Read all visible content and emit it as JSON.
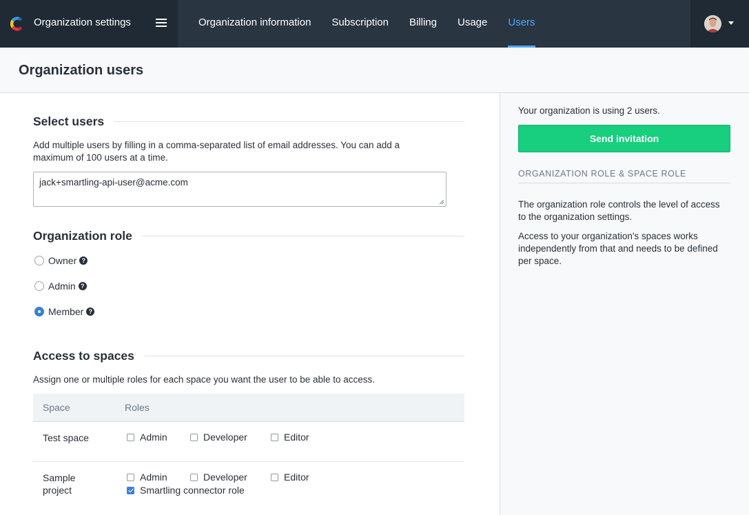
{
  "app": {
    "title": "Organization settings"
  },
  "nav": {
    "tabs": [
      {
        "label": "Organization information"
      },
      {
        "label": "Subscription"
      },
      {
        "label": "Billing"
      },
      {
        "label": "Usage"
      },
      {
        "label": "Users",
        "active": true
      }
    ]
  },
  "page": {
    "title": "Organization users"
  },
  "select_users": {
    "title": "Select users",
    "help": "Add multiple users by filling in a comma-separated list of email addresses. You can add a maximum of 100 users at a time.",
    "email_value": "jack+smartling-api-user@acme.com"
  },
  "org_role": {
    "title": "Organization role",
    "options": [
      {
        "label": "Owner",
        "checked": false
      },
      {
        "label": "Admin",
        "checked": false
      },
      {
        "label": "Member",
        "checked": true
      }
    ]
  },
  "access": {
    "title": "Access to spaces",
    "help": "Assign one or multiple roles for each space you want the user to be able to access.",
    "columns": [
      "Space",
      "Roles"
    ],
    "rows": [
      {
        "space": "Test space",
        "roles": [
          {
            "label": "Admin",
            "checked": false
          },
          {
            "label": "Developer",
            "checked": false
          },
          {
            "label": "Editor",
            "checked": false
          }
        ]
      },
      {
        "space_line1": "Sample",
        "space_line2": "project",
        "roles": [
          {
            "label": "Admin",
            "checked": false
          },
          {
            "label": "Developer",
            "checked": false
          },
          {
            "label": "Editor",
            "checked": false
          },
          {
            "label": "Smartling connector role",
            "checked": true
          }
        ]
      }
    ]
  },
  "sidebar": {
    "usage": "Your organization is using 2 users.",
    "send_button": "Send invitation",
    "heading": "ORGANIZATION ROLE & SPACE ROLE",
    "p1": "The organization role controls the level of access to the organization settings.",
    "p2": "Access to your organization's spaces works independently from that and needs to be defined per space."
  },
  "colors": {
    "accent": "#4fa7ff",
    "primary_button": "#17cf7e",
    "nav_bg": "#2a3542"
  }
}
